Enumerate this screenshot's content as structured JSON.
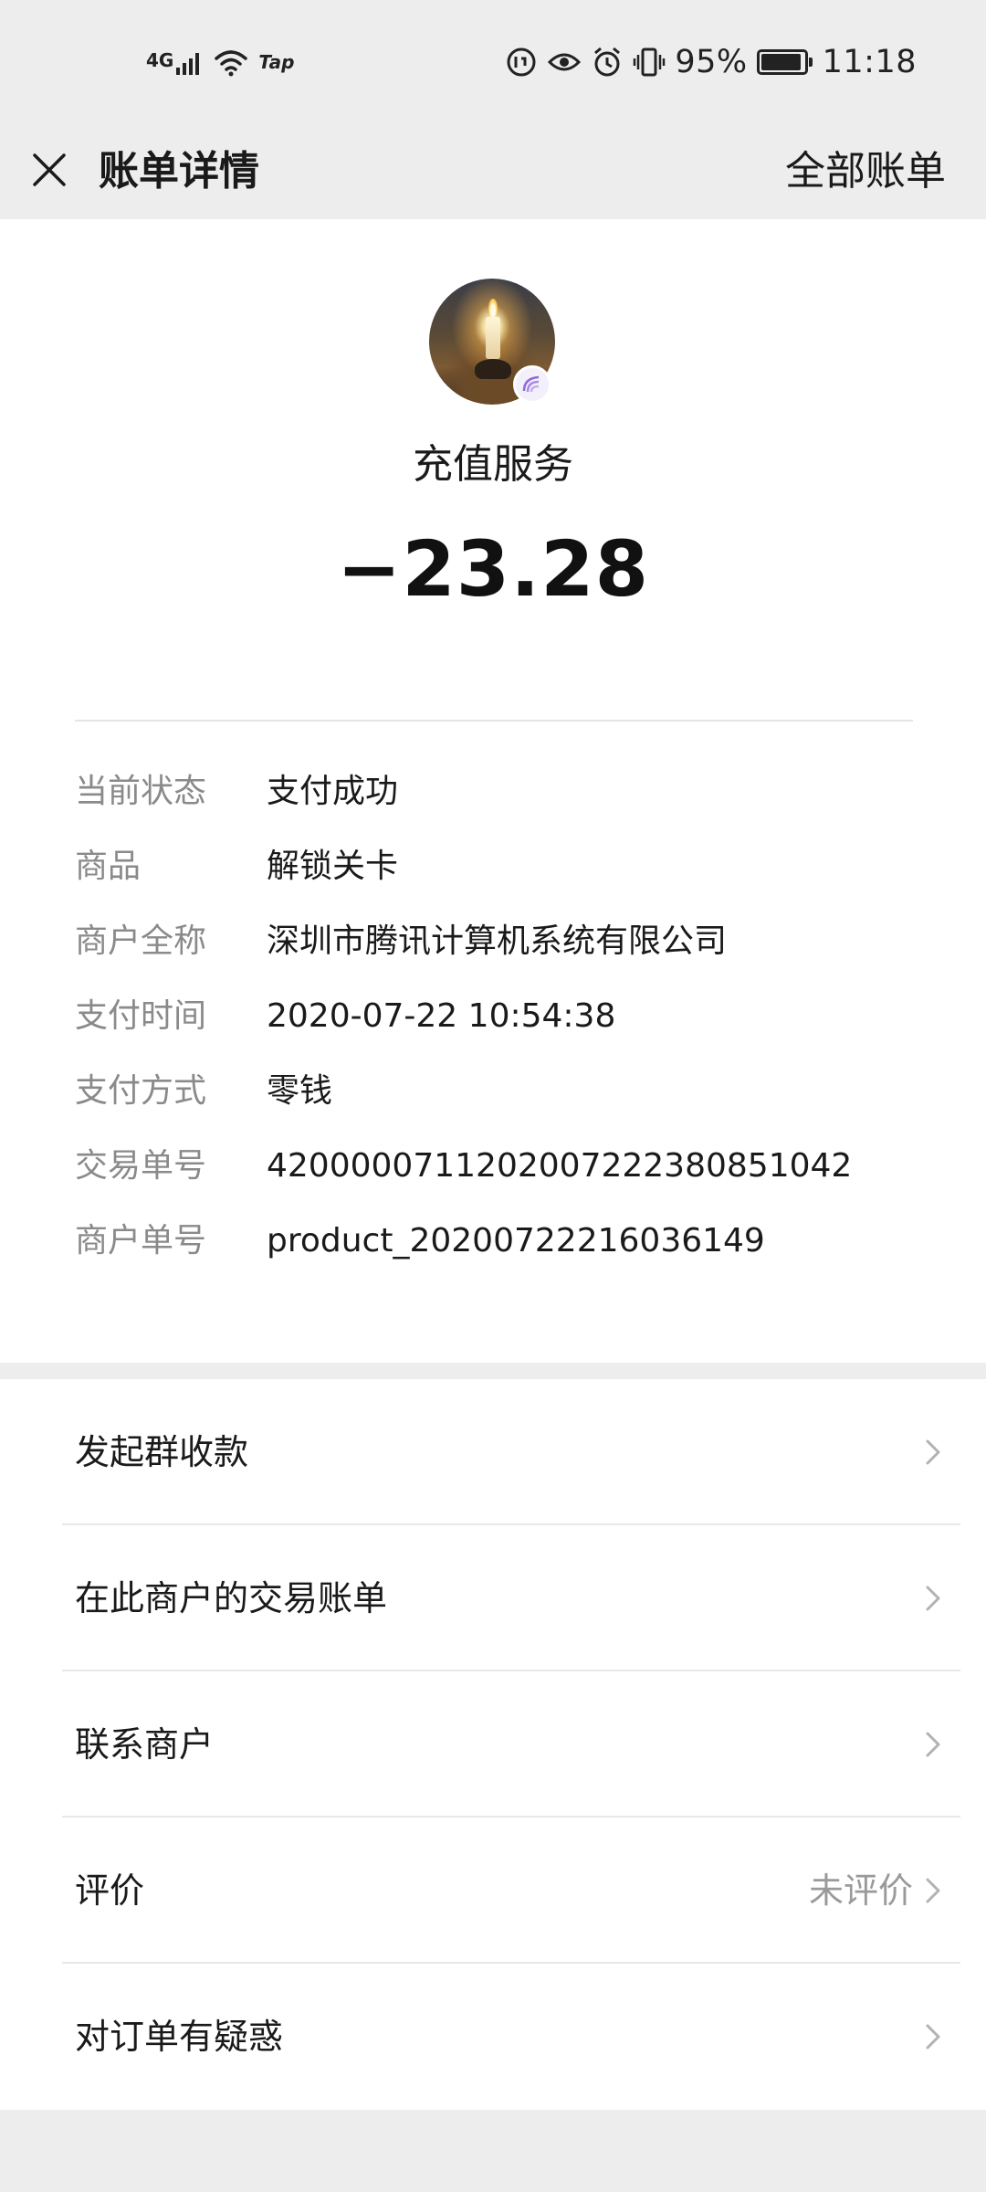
{
  "status_bar": {
    "network": "4G",
    "tap_label": "Tap",
    "battery": "95%",
    "battery_level": 0.95,
    "time": "11:18"
  },
  "nav": {
    "title": "账单详情",
    "action": "全部账单"
  },
  "bill": {
    "merchant_name": "充值服务",
    "amount": "−23.28"
  },
  "details": [
    {
      "label": "当前状态",
      "value": "支付成功"
    },
    {
      "label": "商品",
      "value": "解锁关卡"
    },
    {
      "label": "商户全称",
      "value": "深圳市腾讯计算机系统有限公司"
    },
    {
      "label": "支付时间",
      "value": "2020-07-22 10:54:38"
    },
    {
      "label": "支付方式",
      "value": "零钱"
    },
    {
      "label": "交易单号",
      "value": "4200000711202007222380851042"
    },
    {
      "label": "商户单号",
      "value": "product_20200722216036149"
    }
  ],
  "menu": [
    {
      "label": "发起群收款",
      "sub": ""
    },
    {
      "label": "在此商户的交易账单",
      "sub": ""
    },
    {
      "label": "联系商户",
      "sub": ""
    },
    {
      "label": "评价",
      "sub": "未评价"
    },
    {
      "label": "对订单有疑惑",
      "sub": ""
    }
  ],
  "colors": {
    "background": "#ededed",
    "card": "#ffffff",
    "label_gray": "#8a8a8a",
    "text": "#1a1a1a"
  }
}
